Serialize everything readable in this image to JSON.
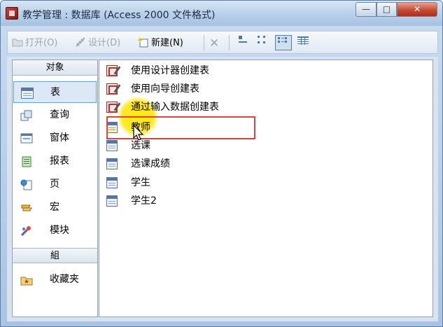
{
  "window": {
    "title": "教学管理 : 数据库 (Access 2000 文件格式)",
    "controls": {
      "minimize": "—",
      "maximize": "□",
      "close": "✕"
    }
  },
  "toolbar": {
    "open_label": "打开(O)",
    "design_label": "设计(D)",
    "new_label": "新建(N)",
    "delete_icon": "x-icon",
    "views": [
      "large-icons",
      "small-icons",
      "list",
      "details"
    ]
  },
  "sidebar": {
    "objects_header": "对象",
    "items": [
      {
        "label": "表",
        "icon": "table-icon"
      },
      {
        "label": "查询",
        "icon": "query-icon"
      },
      {
        "label": "窗体",
        "icon": "form-icon"
      },
      {
        "label": "报表",
        "icon": "report-icon"
      },
      {
        "label": "页",
        "icon": "page-icon"
      },
      {
        "label": "宏",
        "icon": "macro-icon"
      },
      {
        "label": "模块",
        "icon": "module-icon"
      }
    ],
    "groups_header": "組",
    "favorites_label": "收藏夹"
  },
  "list": {
    "items": [
      {
        "label": "使用设计器创建表",
        "icon": "wizard-icon"
      },
      {
        "label": "使用向导创建表",
        "icon": "wizard-icon"
      },
      {
        "label": "通过输入数据创建表",
        "icon": "wizard-icon"
      },
      {
        "label": "教师",
        "icon": "table-icon"
      },
      {
        "label": "选课",
        "icon": "table-icon"
      },
      {
        "label": "选课成绩",
        "icon": "table-icon"
      },
      {
        "label": "学生",
        "icon": "table-icon"
      },
      {
        "label": "学生2",
        "icon": "table-icon"
      }
    ]
  },
  "colors": {
    "highlight_border": "#e04141",
    "cursor_glow": "#ffe600",
    "selection": "#dce8f5"
  }
}
